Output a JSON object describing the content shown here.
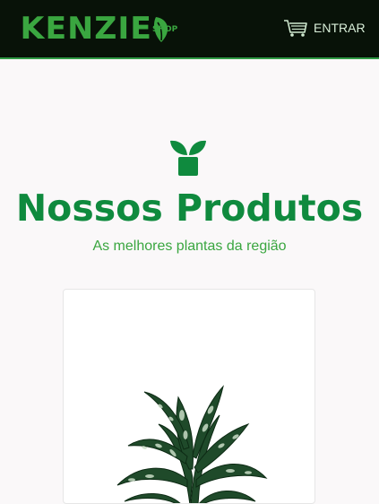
{
  "header": {
    "logo_text": "KENZIE",
    "logo_sub": "SHOP",
    "login_label": "ENTRAR",
    "icon": "cart-icon",
    "background": "#081208",
    "accent": "#3aa640"
  },
  "hero": {
    "icon": "plant-pot-icon",
    "title": "Nossos Produtos",
    "subtitle": "As melhores plantas da região",
    "title_color": "#0f8a3e"
  },
  "products": [
    {
      "image": "aglaonema-plant-image"
    }
  ]
}
